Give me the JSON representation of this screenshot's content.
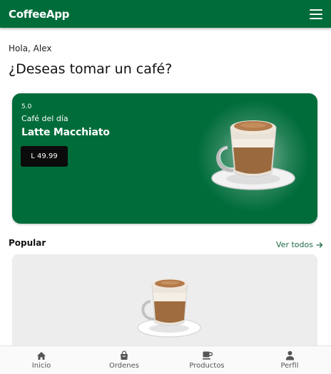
{
  "app": {
    "title": "CoffeeApp"
  },
  "greeting": "Hola, Alex",
  "question": "¿Deseas tomar un café?",
  "featured": {
    "rating": "5.0",
    "label": "Café del día",
    "name": "Latte Macchiato",
    "price": "L 49.99"
  },
  "popular": {
    "title": "Popular",
    "see_all": "Ver todos"
  },
  "nav": {
    "items": [
      {
        "label": "Inicio",
        "icon": "home-icon"
      },
      {
        "label": "Ordenes",
        "icon": "shopping-bag-icon"
      },
      {
        "label": "Productos",
        "icon": "coffee-cup-icon"
      },
      {
        "label": "Perfil",
        "icon": "person-icon"
      }
    ]
  },
  "colors": {
    "primary": "#006C3A",
    "price_bg": "#0b0b0b",
    "card_bg": "#ededed"
  }
}
